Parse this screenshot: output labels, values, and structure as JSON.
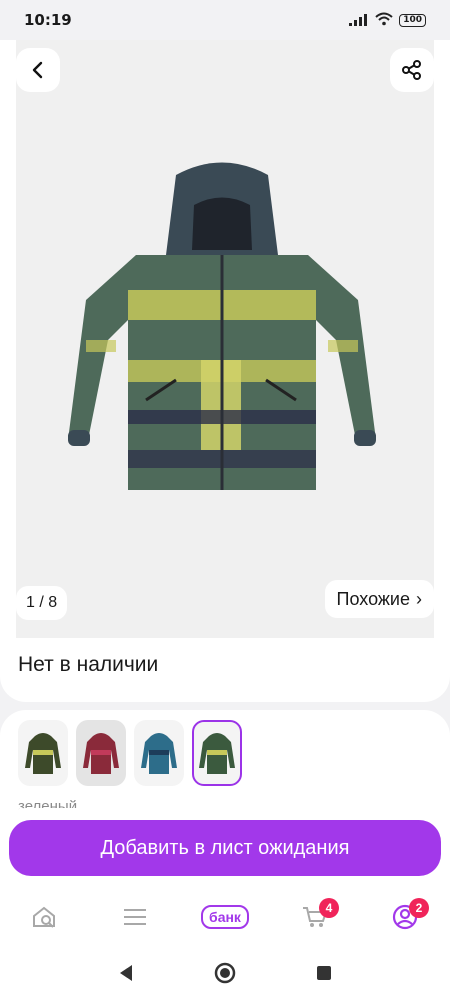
{
  "status": {
    "time": "10:19",
    "battery": "100"
  },
  "gallery": {
    "counter": "1 / 8",
    "similar_label": "Похожие",
    "similar_chevron": "›"
  },
  "product": {
    "availability": "Нет в наличии"
  },
  "variants": {
    "color_name": "зеленый",
    "thumbs": [
      {
        "color": "#3d4a2a"
      },
      {
        "color": "#8a2a3a"
      },
      {
        "color": "#2d6d8a"
      },
      {
        "color": "#3b5a3e"
      }
    ]
  },
  "cta": {
    "label": "Добавить в лист ожидания"
  },
  "tabbar": {
    "bank_label": "банк",
    "cart_badge": "4",
    "profile_badge": "2"
  },
  "colors": {
    "accent": "#a238ea",
    "badge": "#f0245a"
  }
}
